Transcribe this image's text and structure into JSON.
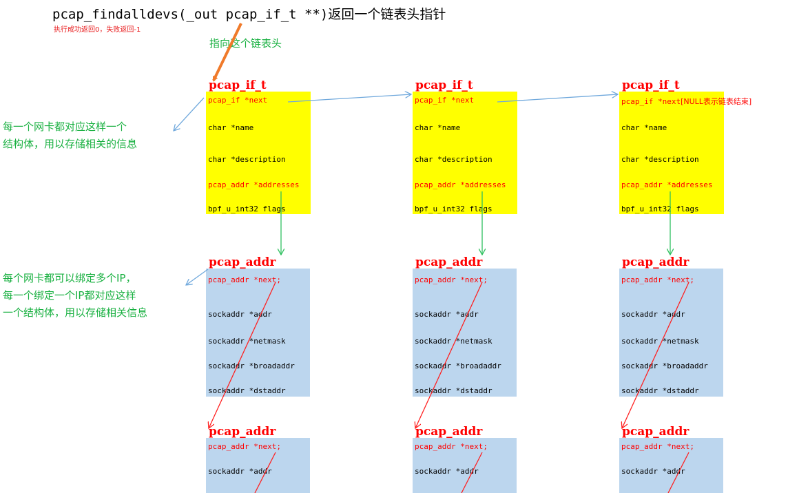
{
  "header": {
    "title": "pcap_findalldevs(_out pcap_if_t **)返回一个链表头指针",
    "subtitle": "执行成功返回0，失败返回-1",
    "head_pointer_label": "指向这个链表头"
  },
  "notes": {
    "if_note_lines": [
      "每一个网卡都对应这样一个",
      "结构体，用以存储相关的信息"
    ],
    "addr_note_lines": [
      "每个网卡都可以绑定多个IP，",
      "每一个绑定一个IP都对应这样",
      "一个结构体，用以存储相关信息"
    ]
  },
  "if_struct": {
    "title": "pcap_if_t",
    "fields": [
      "pcap_if *next",
      "char *name",
      "char *description",
      "pcap_addr *addresses",
      "bpf_u_int32 flags"
    ],
    "last_next_note": "[NULL表示链表结束]"
  },
  "addr_struct": {
    "title": "pcap_addr",
    "fields": [
      "pcap_addr *next;",
      "sockaddr *addr",
      "sockaddr *netmask",
      "sockaddr *broadaddr",
      "sockaddr *dstaddr"
    ]
  },
  "colors": {
    "if_box": "#ffff00",
    "addr_box": "#bcd6ee",
    "title_red": "#ff0000",
    "note_green": "#18b040",
    "arrow_orange": "#f07a2a",
    "arrow_blue": "#6fa8dc",
    "arrow_green": "#30c060",
    "arrow_red": "#ff2020"
  }
}
